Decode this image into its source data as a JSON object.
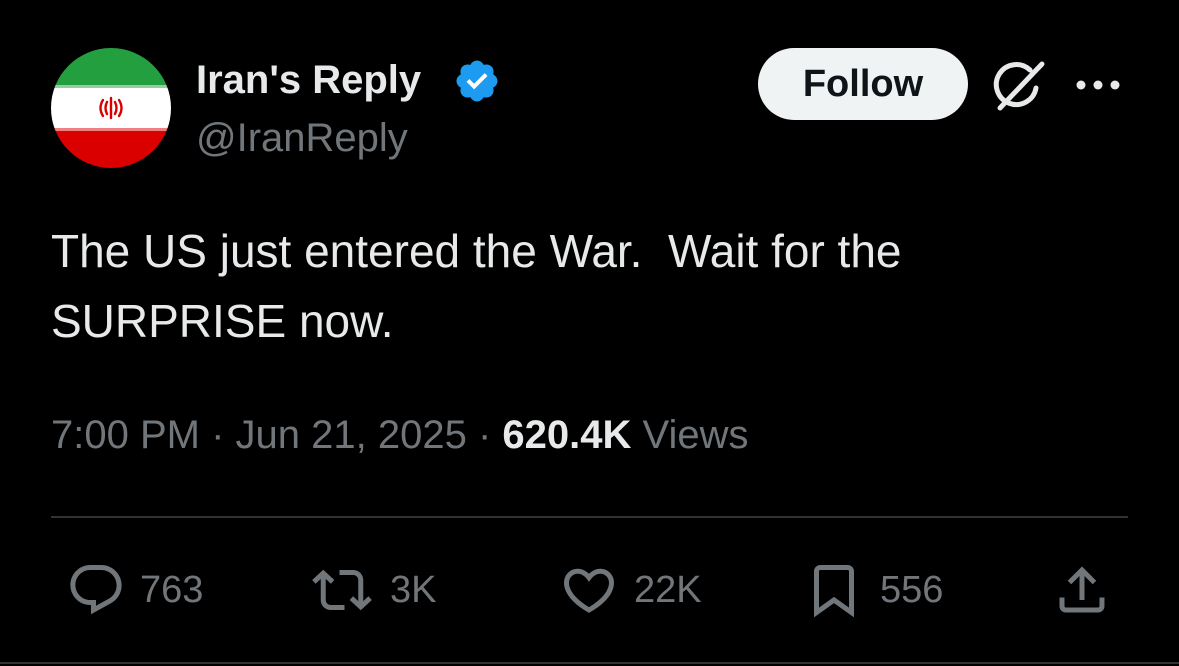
{
  "author": {
    "display_name": "Iran's Reply",
    "handle": "@IranReply",
    "verified": true,
    "avatar": "iran-flag",
    "accent_color": "#1d9bf0"
  },
  "header": {
    "follow_label": "Follow",
    "grok_icon": "grok-icon",
    "more_icon": "more-horizontal-icon"
  },
  "tweet": {
    "text": "The US just entered the War.  Wait for the\nSURPRISE now.",
    "time": "7:00 PM",
    "separator": " · ",
    "date": "Jun 21, 2025",
    "views_count": "620.4K",
    "views_label": "Views"
  },
  "actions": {
    "replies": {
      "icon": "reply-icon",
      "count": "763"
    },
    "reposts": {
      "icon": "repost-icon",
      "count": "3K"
    },
    "likes": {
      "icon": "heart-icon",
      "count": "22K"
    },
    "bookmarks": {
      "icon": "bookmark-icon",
      "count": "556"
    },
    "share": {
      "icon": "share-icon"
    }
  }
}
